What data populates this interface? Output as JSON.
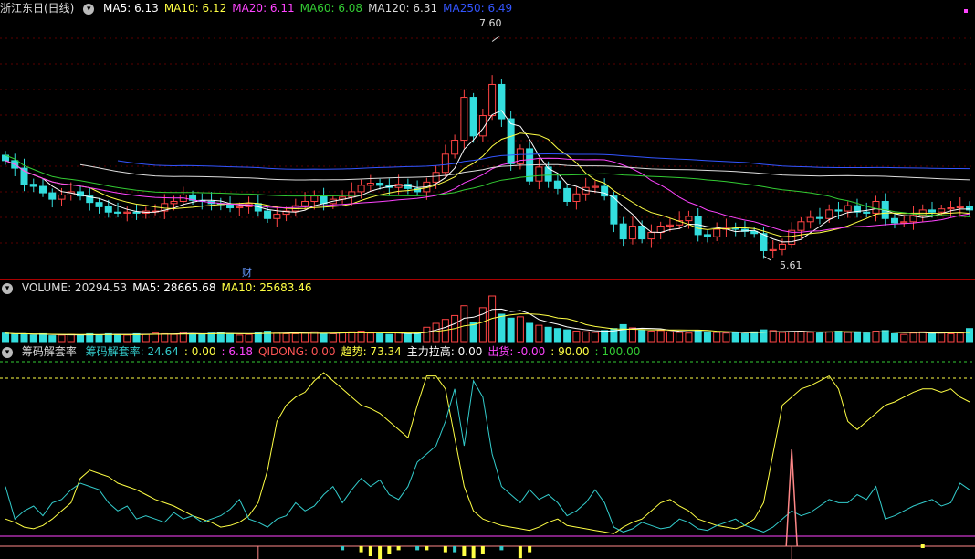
{
  "main": {
    "title": "浙江东日(日线)",
    "ma": [
      {
        "label": "MA5: 6.13",
        "color": "#ffffff"
      },
      {
        "label": "MA10: 6.12",
        "color": "#ffff44"
      },
      {
        "label": "MA20: 6.11",
        "color": "#ff44ff"
      },
      {
        "label": "MA60: 6.08",
        "color": "#33cc33"
      },
      {
        "label": "MA120: 6.31",
        "color": "#dddddd"
      },
      {
        "label": "MA250: 6.49",
        "color": "#3355ff"
      }
    ],
    "high_label": "7.60",
    "low_label": "5.61",
    "event_label": "财"
  },
  "volume": {
    "labels": [
      {
        "label": "VOLUME: 20294.53",
        "color": "#dddddd"
      },
      {
        "label": "MA5: 28665.68",
        "color": "#ffffff"
      },
      {
        "label": "MA10: 25683.46",
        "color": "#ffff44"
      }
    ]
  },
  "indicator": {
    "name": "筹码解套率",
    "labels": [
      {
        "label": "筹码解套率: 24.64",
        "color": "#33cccc"
      },
      {
        "label": ": 0.00",
        "color": "#ffff44"
      },
      {
        "label": ": 6.18",
        "color": "#ff44ff"
      },
      {
        "label": "QIDONG: 0.00",
        "color": "#ff5555"
      },
      {
        "label": "趋势: 73.34",
        "color": "#ffff44"
      },
      {
        "label": "主力拉高: 0.00",
        "color": "#ffffff"
      },
      {
        "label": "出货: -0.00",
        "color": "#ff44ff"
      },
      {
        "label": ": 90.00",
        "color": "#ffff44"
      },
      {
        "label": ": 100.00",
        "color": "#33cc33"
      }
    ]
  },
  "chart_data": {
    "type": "candlestick",
    "price_range": [
      5.4,
      7.75
    ],
    "close": [
      6.44,
      6.37,
      6.22,
      6.2,
      6.14,
      6.08,
      6.12,
      6.15,
      6.11,
      6.05,
      6.01,
      5.96,
      5.95,
      5.96,
      5.95,
      5.97,
      5.97,
      6.04,
      6.06,
      6.12,
      6.07,
      6.06,
      6.04,
      6.03,
      6.0,
      6.01,
      6.04,
      5.97,
      5.9,
      5.94,
      5.97,
      6.02,
      6.06,
      6.11,
      6.04,
      6.08,
      6.1,
      6.15,
      6.21,
      6.23,
      6.21,
      6.19,
      6.22,
      6.18,
      6.15,
      6.24,
      6.33,
      6.5,
      6.63,
      7.03,
      6.67,
      6.86,
      7.15,
      6.83,
      6.41,
      6.55,
      6.25,
      6.38,
      6.25,
      6.18,
      6.06,
      6.13,
      6.19,
      6.2,
      6.11,
      5.85,
      5.71,
      5.83,
      5.71,
      5.77,
      5.83,
      5.84,
      5.88,
      5.92,
      5.75,
      5.73,
      5.8,
      5.81,
      5.8,
      5.78,
      5.76,
      5.6,
      5.61,
      5.66,
      5.79,
      5.87,
      5.91,
      5.9,
      5.98,
      5.97,
      6.02,
      5.96,
      5.95,
      6.06,
      5.9,
      5.86,
      5.87,
      5.93,
      5.98,
      5.96,
      5.99,
      6.0,
      6.01,
      5.98
    ],
    "volume": [
      13,
      11,
      12,
      10,
      12,
      9,
      10,
      11,
      10,
      12,
      10,
      12,
      11,
      10,
      12,
      11,
      13,
      12,
      11,
      14,
      12,
      11,
      13,
      14,
      12,
      10,
      11,
      14,
      16,
      13,
      12,
      12,
      13,
      15,
      12,
      12,
      14,
      15,
      16,
      13,
      12,
      11,
      14,
      12,
      13,
      22,
      28,
      34,
      40,
      55,
      30,
      52,
      70,
      42,
      36,
      38,
      28,
      25,
      22,
      20,
      18,
      16,
      15,
      14,
      17,
      20,
      26,
      21,
      18,
      16,
      17,
      15,
      14,
      13,
      17,
      15,
      14,
      13,
      14,
      12,
      15,
      18,
      17,
      14,
      15,
      16,
      14,
      13,
      15,
      16,
      14,
      15,
      13,
      16,
      17,
      12,
      11,
      13,
      15,
      14,
      13,
      12,
      13,
      20
    ],
    "indicator_series": {
      "jietao": [
        0.3,
        0.1,
        0.15,
        0.18,
        0.12,
        0.2,
        0.22,
        0.28,
        0.32,
        0.3,
        0.28,
        0.2,
        0.15,
        0.18,
        0.1,
        0.12,
        0.1,
        0.08,
        0.14,
        0.1,
        0.12,
        0.08,
        0.1,
        0.12,
        0.16,
        0.22,
        0.1,
        0.08,
        0.05,
        0.1,
        0.12,
        0.2,
        0.15,
        0.18,
        0.25,
        0.3,
        0.2,
        0.28,
        0.35,
        0.3,
        0.34,
        0.25,
        0.22,
        0.3,
        0.45,
        0.5,
        0.55,
        0.7,
        0.9,
        0.55,
        0.95,
        0.85,
        0.5,
        0.3,
        0.25,
        0.2,
        0.28,
        0.22,
        0.25,
        0.2,
        0.12,
        0.15,
        0.2,
        0.28,
        0.2,
        0.05,
        0.02,
        0.04,
        0.08,
        0.06,
        0.04,
        0.05,
        0.1,
        0.08,
        0.04,
        0.03,
        0.06,
        0.08,
        0.1,
        0.06,
        0.04,
        0.02,
        0.05,
        0.1,
        0.15,
        0.12,
        0.14,
        0.18,
        0.22,
        0.2,
        0.2,
        0.25,
        0.22,
        0.3,
        0.1,
        0.12,
        0.15,
        0.18,
        0.2,
        0.22,
        0.18,
        0.2,
        0.32,
        0.28
      ],
      "trend": [
        0.1,
        0.08,
        0.05,
        0.04,
        0.06,
        0.1,
        0.15,
        0.2,
        0.35,
        0.4,
        0.38,
        0.36,
        0.32,
        0.3,
        0.28,
        0.25,
        0.22,
        0.2,
        0.18,
        0.15,
        0.12,
        0.1,
        0.08,
        0.05,
        0.06,
        0.08,
        0.12,
        0.2,
        0.4,
        0.7,
        0.8,
        0.85,
        0.88,
        0.95,
        1.0,
        0.95,
        0.9,
        0.85,
        0.8,
        0.78,
        0.75,
        0.7,
        0.65,
        0.6,
        0.8,
        0.98,
        0.98,
        0.9,
        0.6,
        0.3,
        0.15,
        0.1,
        0.08,
        0.06,
        0.05,
        0.04,
        0.03,
        0.05,
        0.08,
        0.1,
        0.06,
        0.05,
        0.04,
        0.03,
        0.02,
        0.01,
        0.05,
        0.08,
        0.1,
        0.15,
        0.2,
        0.22,
        0.18,
        0.15,
        0.1,
        0.08,
        0.06,
        0.05,
        0.04,
        0.06,
        0.1,
        0.2,
        0.5,
        0.8,
        0.85,
        0.9,
        0.92,
        0.95,
        0.98,
        0.9,
        0.7,
        0.65,
        0.7,
        0.75,
        0.8,
        0.82,
        0.85,
        0.88,
        0.9,
        0.9,
        0.88,
        0.9,
        0.85,
        0.82
      ],
      "qidong_spike_index": 84,
      "event_index": 27
    }
  }
}
